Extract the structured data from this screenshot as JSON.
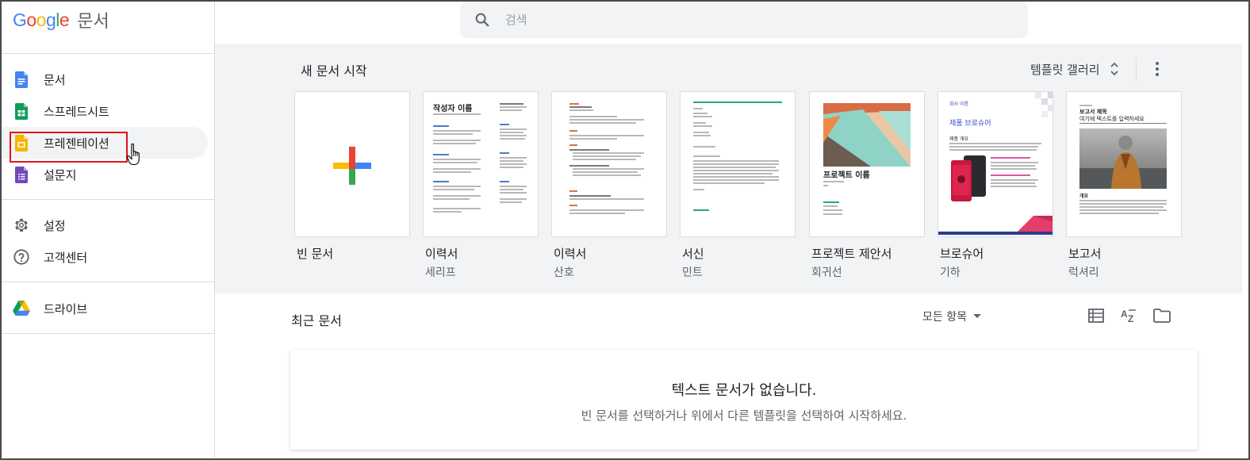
{
  "app": {
    "logo_letters": [
      "G",
      "o",
      "o",
      "g",
      "l",
      "e"
    ],
    "logo_colors": [
      "#4285f4",
      "#ea4335",
      "#fbbc05",
      "#4285f4",
      "#34a853",
      "#ea4335"
    ],
    "title": "문서"
  },
  "sidebar": {
    "items": [
      {
        "label": "문서",
        "icon": "docs-icon",
        "color": "#4285f4"
      },
      {
        "label": "스프레드시트",
        "icon": "sheets-icon",
        "color": "#0f9d58"
      },
      {
        "label": "프레젠테이션",
        "icon": "slides-icon",
        "color": "#f4b400",
        "active": true
      },
      {
        "label": "설문지",
        "icon": "forms-icon",
        "color": "#7248b9"
      },
      {
        "label": "설정",
        "icon": "gear-icon"
      },
      {
        "label": "고객센터",
        "icon": "help-icon"
      },
      {
        "label": "드라이브",
        "icon": "drive-icon"
      }
    ]
  },
  "search": {
    "placeholder": "검색"
  },
  "templates": {
    "section_title": "새 문서 시작",
    "gallery_label": "템플릿 갤러리",
    "items": [
      {
        "name": "빈 문서",
        "sub": ""
      },
      {
        "name": "이력서",
        "sub": "세리프"
      },
      {
        "name": "이력서",
        "sub": "산호"
      },
      {
        "name": "서신",
        "sub": "민트"
      },
      {
        "name": "프로젝트 제안서",
        "sub": "회귀선"
      },
      {
        "name": "브로슈어",
        "sub": "기하"
      },
      {
        "name": "보고서",
        "sub": "럭셔리"
      }
    ],
    "thumb_text": {
      "resume_name": "작성자 이름",
      "proposal_title": "프로젝트 이름",
      "brochure_company": "회사 이름",
      "brochure_title": "제품 브로슈어",
      "brochure_sub": "제품 개요",
      "report_title": "보고서 제목",
      "report_sub": "여기에 텍스트를 입력하세요",
      "report_section": "개요"
    }
  },
  "recent": {
    "title": "최근 문서",
    "filter_label": "모든 항목",
    "empty_title": "텍스트 문서가 없습니다.",
    "empty_sub": "빈 문서를 선택하거나 위에서 다른 템플릿을 선택하여 시작하세요."
  }
}
